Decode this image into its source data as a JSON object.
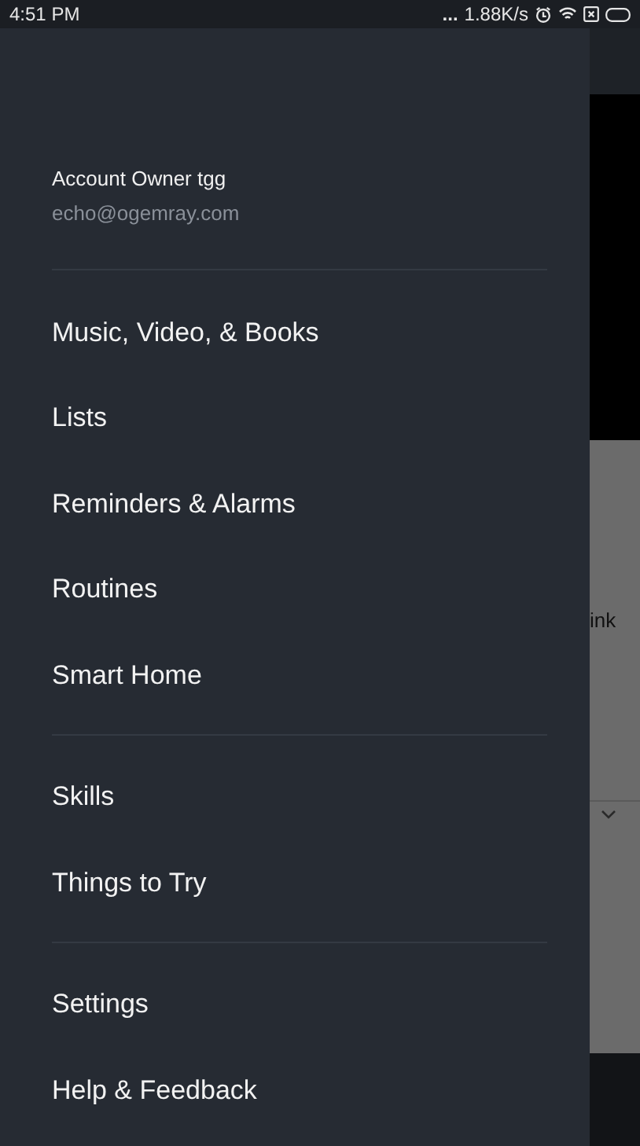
{
  "status_bar": {
    "time": "4:51 PM",
    "dots": "...",
    "speed": "1.88K/s"
  },
  "account": {
    "name": "Account Owner tgg",
    "email": "echo@ogemray.com"
  },
  "menu_sections": [
    {
      "items": [
        "Music, Video, & Books",
        "Lists",
        "Reminders & Alarms",
        "Routines",
        "Smart Home"
      ]
    },
    {
      "items": [
        "Skills",
        "Things to Try"
      ]
    },
    {
      "items": [
        "Settings",
        "Help & Feedback"
      ]
    }
  ],
  "background": {
    "link_text": "ink"
  }
}
